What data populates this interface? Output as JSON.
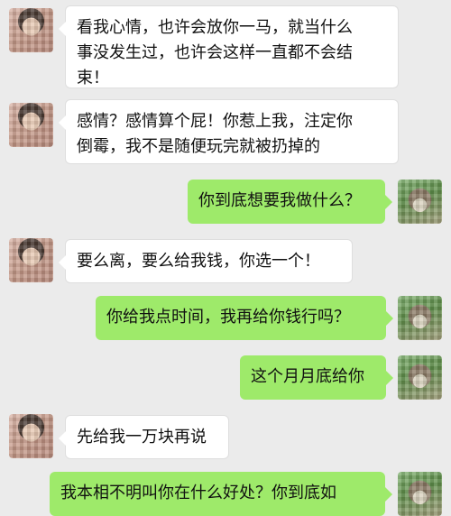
{
  "messages": [
    {
      "side": "left",
      "text": "看我心情，也许会放你一马，就当什么\n事没发生过，也许会这样一直都不会结\n束！"
    },
    {
      "side": "left",
      "text": "感情？感情算个屁！你惹上我，注定你\n倒霉，我不是随便玩完就被扔掉的"
    },
    {
      "side": "right",
      "text": "你到底想要我做什么？"
    },
    {
      "side": "left",
      "text": "要么离，要么给我钱，你选一个！"
    },
    {
      "side": "right",
      "text": "你给我点时间，我再给你钱行吗？"
    },
    {
      "side": "right",
      "text": "这个月月底给你"
    },
    {
      "side": "left",
      "text": "先给我一万块再说"
    },
    {
      "side": "right",
      "text": "我本相不明叫你在什么好处？你到底如"
    }
  ]
}
